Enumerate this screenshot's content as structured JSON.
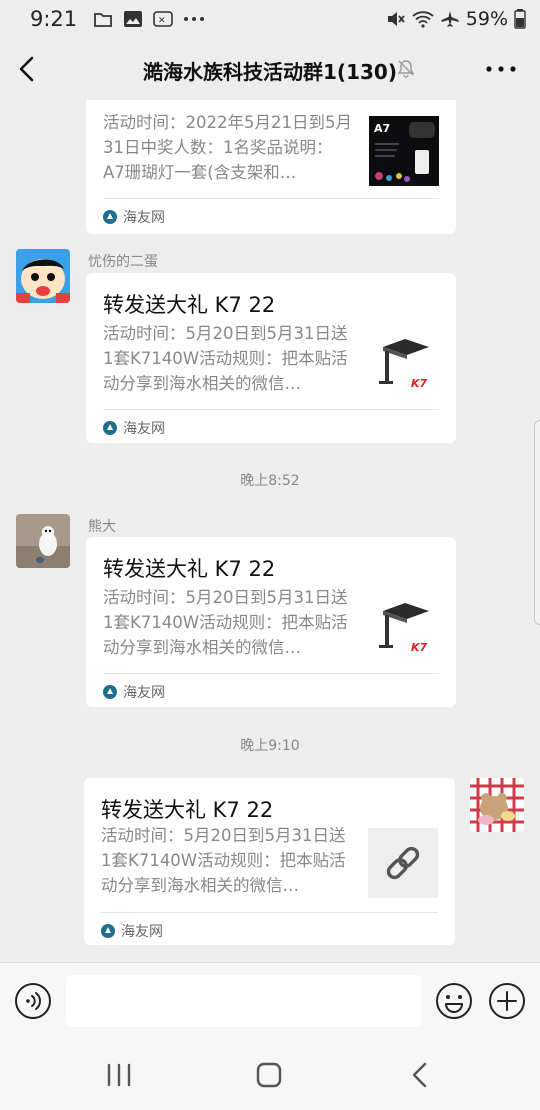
{
  "status_bar": {
    "time": "9:21",
    "battery_percent": "59%",
    "left_icons": [
      "folder-icon",
      "gallery-icon",
      "wechat-icon",
      "more-dots-icon"
    ],
    "right_icons": [
      "mute-icon",
      "wifi-icon",
      "airplane-icon",
      "battery-icon"
    ]
  },
  "header": {
    "title": "澔海水族科技活动群1(130)",
    "muted": true
  },
  "messages": [
    {
      "kind": "link_card",
      "direction": "incoming",
      "partial_top": true,
      "title": "",
      "desc": "活动时间：2022年5月21日到5月31日中奖人数：1名奖品说明：A7珊瑚灯一套(含支架和…",
      "thumb": "a7-light-image",
      "thumb_text": "A7",
      "source": "海友网"
    },
    {
      "kind": "link_card",
      "direction": "incoming",
      "sender": "忧伤的二蛋",
      "avatar": "cartoon-avatar",
      "title": "转发送大礼 K7 22",
      "desc": "活动时间：5月20日到5月31日送1套K7140W活动规则：把本贴活动分享到海水相关的微信…",
      "thumb": "k7-lamp-image",
      "thumb_text": "K7",
      "source": "海友网"
    },
    {
      "kind": "timestamp",
      "text": "晚上8:52"
    },
    {
      "kind": "link_card",
      "direction": "incoming",
      "sender": "熊大",
      "avatar": "dog-photo-avatar",
      "title": "转发送大礼 K7 22",
      "desc": "活动时间：5月20日到5月31日送1套K7140W活动规则：把本贴活动分享到海水相关的微信…",
      "thumb": "k7-lamp-image",
      "thumb_text": "K7",
      "source": "海友网"
    },
    {
      "kind": "timestamp",
      "text": "晚上9:10"
    },
    {
      "kind": "link_card",
      "direction": "outgoing",
      "avatar": "bear-photo-avatar",
      "title": "转发送大礼 K7 22",
      "desc": "活动时间：5月20日到5月31日送1套K7140W活动规则：把本贴活动分享到海水相关的微信…",
      "thumb": "link-placeholder-icon",
      "source": "海友网"
    }
  ],
  "input_bar": {
    "value": "",
    "icons": [
      "voice-icon",
      "emoji-icon",
      "plus-icon"
    ]
  },
  "nav_bar": {
    "icons": [
      "recent-apps-icon",
      "home-icon",
      "back-icon"
    ]
  },
  "colors": {
    "background": "#ededed",
    "card": "#ffffff",
    "muted_text": "#888888",
    "source_icon": "#1f6e8c"
  }
}
